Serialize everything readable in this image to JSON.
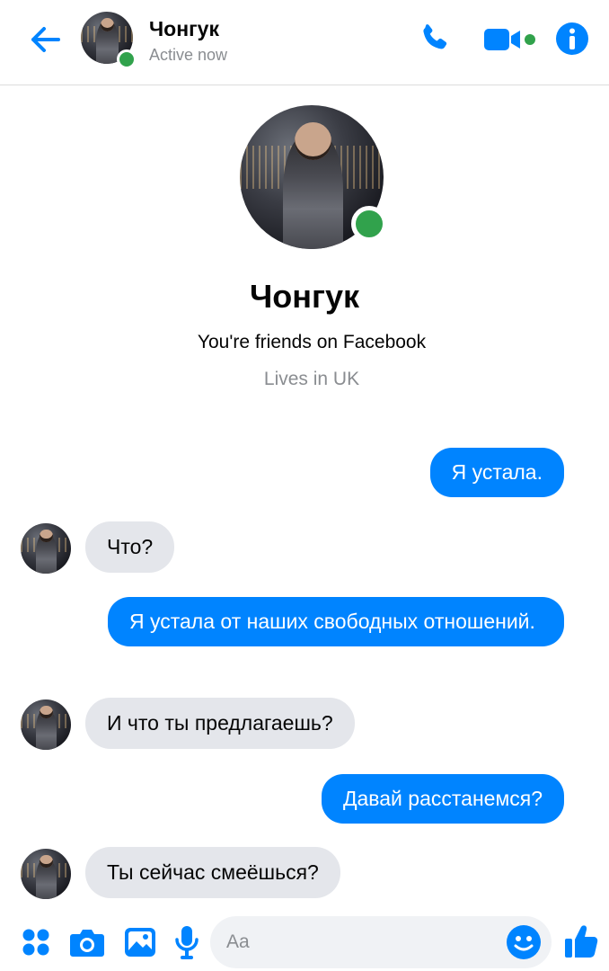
{
  "header": {
    "contact_name": "Чонгук",
    "status": "Active now",
    "icons": {
      "back": "back-arrow-icon",
      "call": "phone-icon",
      "video": "video-camera-icon",
      "info": "info-icon"
    }
  },
  "profile": {
    "name": "Чонгук",
    "friends_text": "You're friends on Facebook",
    "lives_text": "Lives in UK"
  },
  "messages": [
    {
      "direction": "outgoing",
      "text": "Я устала."
    },
    {
      "direction": "incoming",
      "text": "Что?"
    },
    {
      "direction": "outgoing",
      "text": "Я устала от наших свободных отношений."
    },
    {
      "direction": "incoming",
      "text": "И что ты предлагаешь?"
    },
    {
      "direction": "outgoing",
      "text": "Давай расстанемся?"
    },
    {
      "direction": "incoming",
      "text": "Ты сейчас смеёшься?"
    }
  ],
  "composer": {
    "placeholder": "Aa",
    "icons": [
      "grid-menu-icon",
      "camera-icon",
      "image-icon",
      "microphone-icon",
      "emoji-icon",
      "thumbs-up-icon"
    ]
  },
  "colors": {
    "accent": "#0084ff",
    "online": "#31a24c",
    "incoming_bubble": "#e4e6eb",
    "muted_text": "#8a8d91"
  }
}
